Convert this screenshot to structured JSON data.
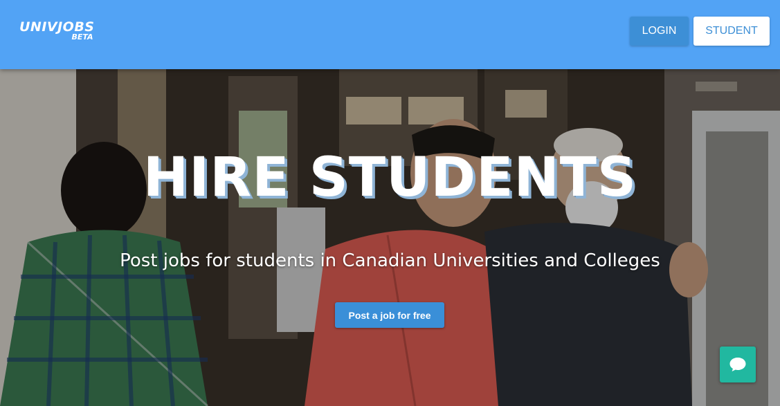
{
  "header": {
    "logo": {
      "main": "UNIVJOBS",
      "sub": "BETA"
    },
    "login_label": "LOGIN",
    "student_label": "STUDENT"
  },
  "hero": {
    "title": "HIRE STUDENTS",
    "subtitle": "Post jobs for students in Canadian Universities and Colleges",
    "cta_label": "Post a job for free"
  },
  "chat": {
    "icon": "chat-bubble-icon"
  },
  "colors": {
    "header_bg": "#52a3f5",
    "login_bg": "#3d8fd6",
    "student_bg": "#ffffff",
    "cta_bg": "#3a8fd8",
    "chat_bg": "#21b8a0"
  }
}
